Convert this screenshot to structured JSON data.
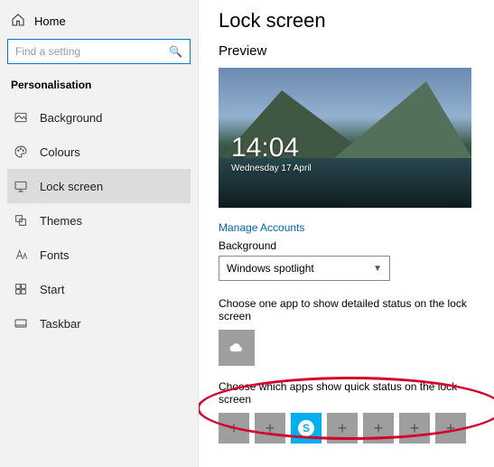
{
  "sidebar": {
    "home_label": "Home",
    "search_placeholder": "Find a setting",
    "section_title": "Personalisation",
    "items": [
      {
        "label": "Background",
        "selected": false
      },
      {
        "label": "Colours",
        "selected": false
      },
      {
        "label": "Lock screen",
        "selected": true
      },
      {
        "label": "Themes",
        "selected": false
      },
      {
        "label": "Fonts",
        "selected": false
      },
      {
        "label": "Start",
        "selected": false
      },
      {
        "label": "Taskbar",
        "selected": false
      }
    ]
  },
  "main": {
    "title": "Lock screen",
    "preview_label": "Preview",
    "clock_time": "14:04",
    "clock_date": "Wednesday 17 April",
    "manage_accounts_link": "Manage Accounts",
    "background_label": "Background",
    "background_value": "Windows spotlight",
    "detailed_status_desc": "Choose one app to show detailed status on the lock screen",
    "detailed_app": "weather",
    "quick_status_desc": "Choose which apps show quick status on the lock screen",
    "quick_slots": [
      {
        "type": "add"
      },
      {
        "type": "add"
      },
      {
        "type": "skype"
      },
      {
        "type": "add"
      },
      {
        "type": "add"
      },
      {
        "type": "add"
      },
      {
        "type": "add"
      }
    ]
  }
}
